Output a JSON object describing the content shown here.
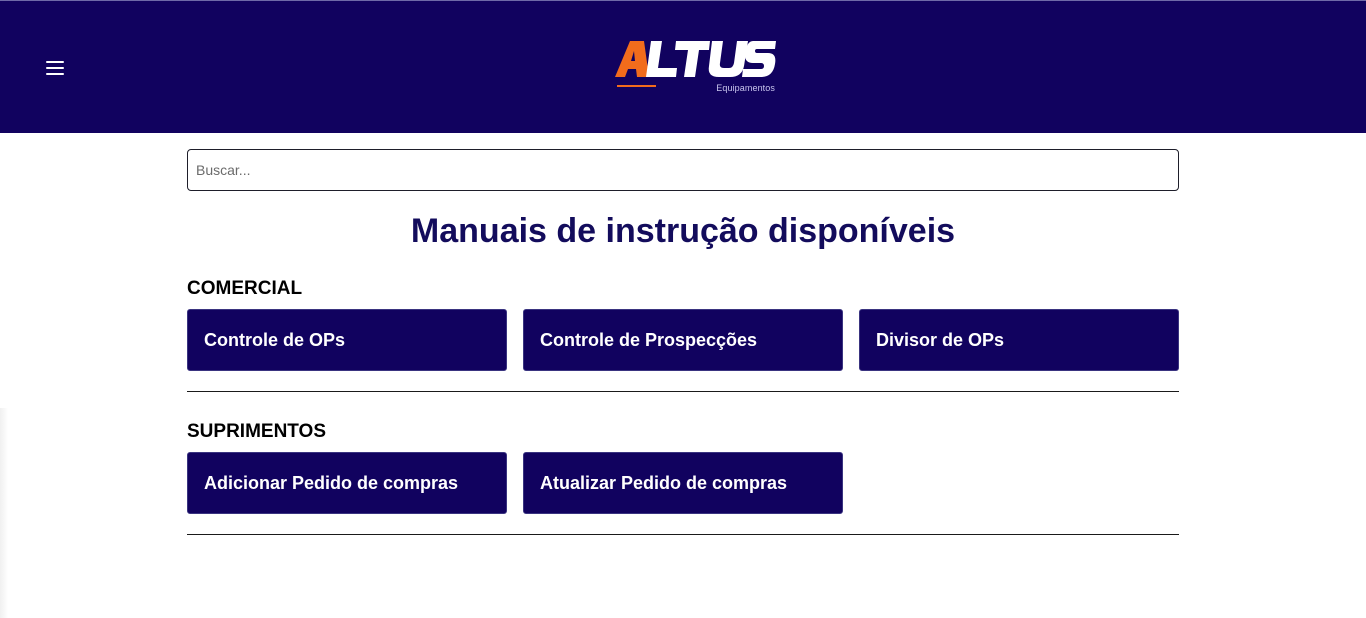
{
  "header": {
    "menu_icon": "hamburger-menu-icon",
    "logo_text": "ALTUS",
    "logo_subtitle": "Equipamentos",
    "background_color": "#11025f",
    "accent_color": "#f26c1c"
  },
  "search": {
    "placeholder": "Buscar...",
    "value": ""
  },
  "main": {
    "title": "Manuais de instrução disponíveis",
    "sections": [
      {
        "title": "COMERCIAL",
        "items": [
          {
            "label": "Controle de OPs"
          },
          {
            "label": "Controle de Prospecções"
          },
          {
            "label": "Divisor de OPs"
          }
        ]
      },
      {
        "title": "SUPRIMENTOS",
        "items": [
          {
            "label": "Adicionar Pedido de compras"
          },
          {
            "label": "Atualizar Pedido de compras"
          }
        ]
      }
    ]
  }
}
